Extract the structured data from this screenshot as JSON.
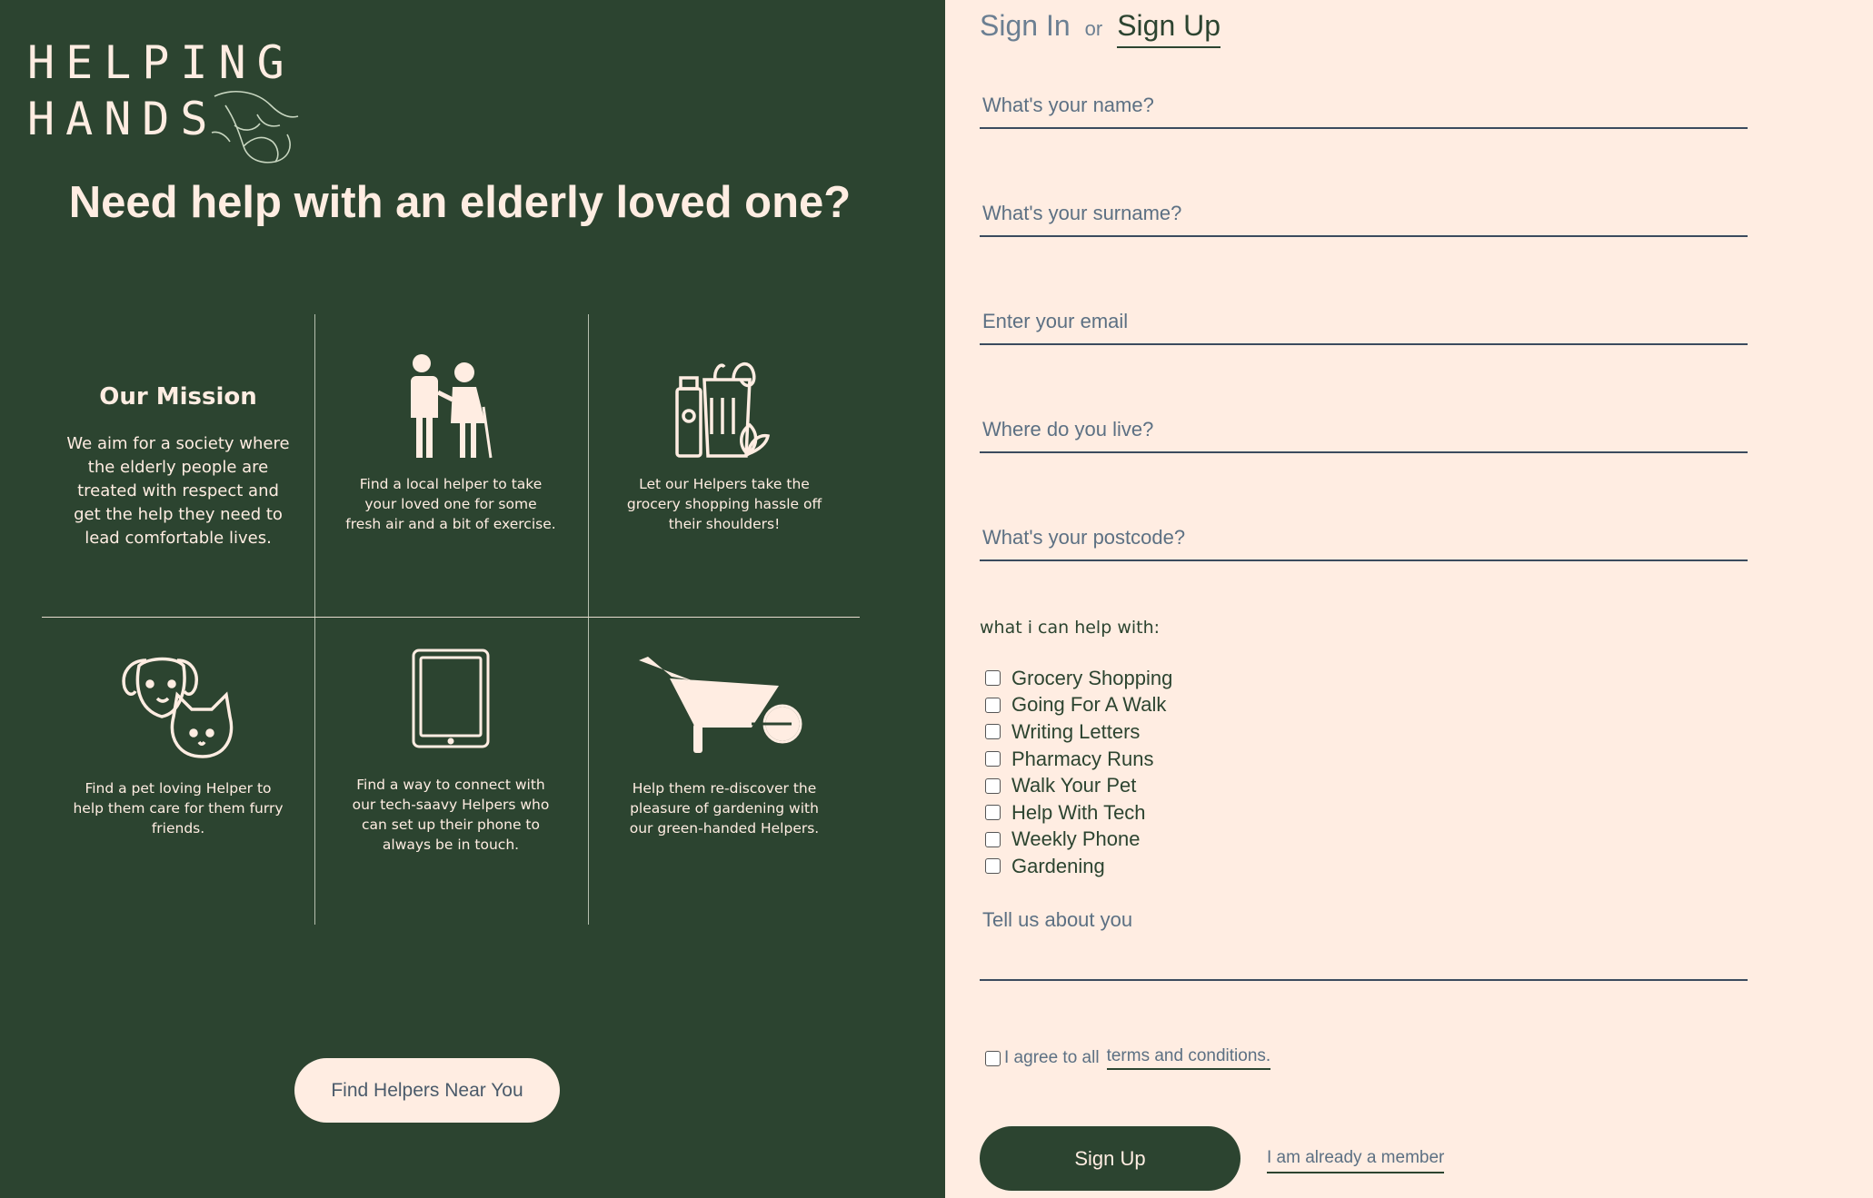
{
  "logo": {
    "line1": "HELPING",
    "line2": "HANDS",
    "icon": "holding-hands-icon"
  },
  "hero": {
    "title": "Need help with an elderly loved one?"
  },
  "mission": {
    "title": "Our Mission",
    "text": "We aim for a society where the elderly people are treated with respect and get the help they need to lead comfortable lives."
  },
  "services": [
    {
      "icon": "elderly-couple-icon",
      "text": "Find a local helper to take your loved one for some fresh air and a bit of exercise."
    },
    {
      "icon": "grocery-bag-icon",
      "text": "Let our Helpers take the grocery shopping hassle off their shoulders!"
    },
    {
      "icon": "dog-and-cat-icon",
      "text": "Find a pet loving Helper to help them care for them furry friends."
    },
    {
      "icon": "tablet-icon",
      "text": "Find a way to connect with our tech-saavy Helpers who can set up their phone to always be in touch."
    },
    {
      "icon": "wheelbarrow-icon",
      "text": "Help them re-discover the pleasure of gardening with our green-handed Helpers."
    }
  ],
  "cta": {
    "find_helpers": "Find Helpers Near You"
  },
  "auth": {
    "sign_in": "Sign In",
    "or": "or",
    "sign_up": "Sign Up"
  },
  "form": {
    "name_placeholder": "What's your name?",
    "surname_placeholder": "What's your surname?",
    "email_placeholder": "Enter your email",
    "location_placeholder": "Where do you live?",
    "postcode_placeholder": "What's your postcode?",
    "help_label": "what i can help with:",
    "help_options": [
      "Grocery Shopping",
      "Going For A Walk",
      "Writing Letters",
      "Pharmacy Runs",
      "Walk Your Pet",
      "Help With Tech",
      "Weekly Phone",
      "Gardening"
    ],
    "about_placeholder": "Tell us about you",
    "agree_text": "I agree to all",
    "terms_link": "terms and conditions.",
    "submit": "Sign Up",
    "member_link": "I am already a member"
  },
  "colors": {
    "dark_green": "#2c4430",
    "cream": "#ffede2",
    "muted_text": "#5c7083"
  }
}
